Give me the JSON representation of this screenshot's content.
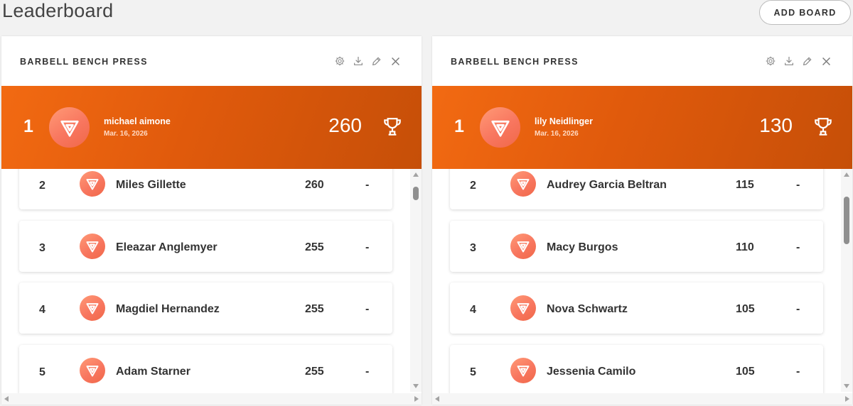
{
  "page": {
    "title": "Leaderboard",
    "add_board_label": "ADD BOARD"
  },
  "boards": [
    {
      "title": "BARBELL BENCH PRESS",
      "leader": {
        "rank": "1",
        "name": "michael aimone",
        "date": "Mar. 16, 2026",
        "score": "260"
      },
      "rows": [
        {
          "rank": "2",
          "name": "Miles Gillette",
          "score": "260",
          "change": "-"
        },
        {
          "rank": "3",
          "name": "Eleazar Anglemyer",
          "score": "255",
          "change": "-"
        },
        {
          "rank": "4",
          "name": "Magdiel Hernandez",
          "score": "255",
          "change": "-"
        },
        {
          "rank": "5",
          "name": "Adam Starner",
          "score": "255",
          "change": "-"
        }
      ]
    },
    {
      "title": "BARBELL BENCH PRESS",
      "leader": {
        "rank": "1",
        "name": "lily Neidlinger",
        "date": "Mar. 16, 2026",
        "score": "130"
      },
      "rows": [
        {
          "rank": "2",
          "name": "Audrey Garcia Beltran",
          "score": "115",
          "change": "-"
        },
        {
          "rank": "3",
          "name": "Macy Burgos",
          "score": "110",
          "change": "-"
        },
        {
          "rank": "4",
          "name": "Nova Schwartz",
          "score": "105",
          "change": "-"
        },
        {
          "rank": "5",
          "name": "Jessenia Camilo",
          "score": "105",
          "change": "-"
        }
      ]
    }
  ],
  "icons": {
    "settings": "gear-icon",
    "download": "download-icon",
    "edit": "pencil-icon",
    "close": "close-icon",
    "trophy": "trophy-icon",
    "avatar": "brand-logo-icon"
  },
  "colors": {
    "leader_gradient_start": "#f26a12",
    "leader_gradient_end": "#c64f08",
    "avatar": "#f8765f",
    "background": "#f2f2f2"
  }
}
